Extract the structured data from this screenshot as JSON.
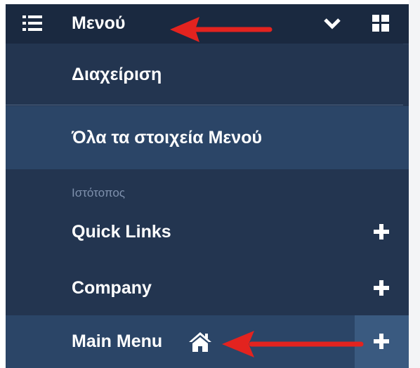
{
  "header": {
    "title": "Μενού",
    "icons": {
      "menu": "list-icon",
      "toggle": "chevron-down-icon",
      "grid": "grid-icon"
    }
  },
  "nav": {
    "manage_label": "Διαχείριση",
    "all_items_label": "Όλα τα στοιχεία Μενού",
    "section_heading": "Ιστότοπος",
    "menus": [
      {
        "label": "Quick Links",
        "action_icon": "plus-icon"
      },
      {
        "label": "Company",
        "action_icon": "plus-icon"
      },
      {
        "label": "Main Menu",
        "badge_icon": "home-icon",
        "action_icon": "plus-icon"
      }
    ]
  },
  "colors": {
    "panel_background": "#233550",
    "header_background": "#1a2940",
    "highlight_background": "#2b4567",
    "accent_button": "#3a5a80",
    "section_text": "#7f91ad",
    "annotation_arrow": "#e3231f"
  }
}
